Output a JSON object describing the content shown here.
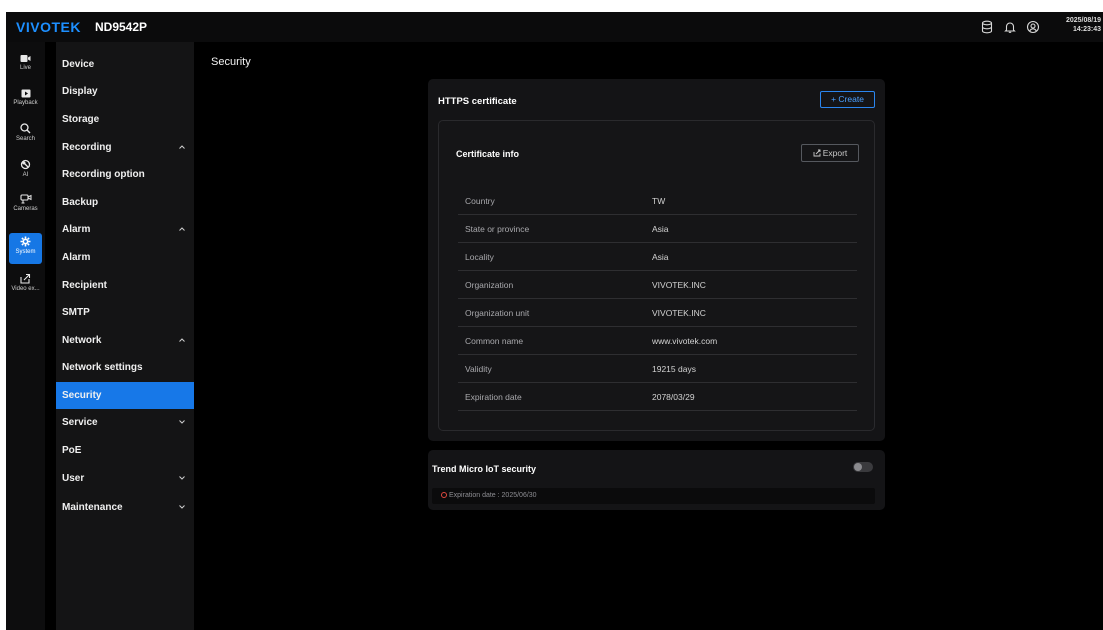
{
  "header": {
    "brand": "VIVOTEK",
    "model": "ND9542P",
    "date": "2025/08/19",
    "time": "14:23:43",
    "icons": [
      "database-icon",
      "bell-icon",
      "user-circle-icon"
    ]
  },
  "rail": [
    {
      "label": "Live",
      "icon": "camera-icon"
    },
    {
      "label": "Playback",
      "icon": "play-icon"
    },
    {
      "label": "Search",
      "icon": "search-icon"
    },
    {
      "label": "AI",
      "icon": "ai-icon"
    },
    {
      "label": "Cameras",
      "icon": "cameras-icon"
    },
    {
      "label": "System",
      "icon": "gear-icon",
      "active": true
    },
    {
      "label": "Video ex...",
      "icon": "export-icon"
    }
  ],
  "menu": {
    "items": [
      {
        "label": "Device"
      },
      {
        "label": "Display"
      },
      {
        "label": "Storage"
      },
      {
        "label": "Recording",
        "chevron": "up"
      },
      {
        "label": "Recording option"
      },
      {
        "label": "Backup"
      },
      {
        "label": "Alarm",
        "chevron": "up"
      },
      {
        "label": "Alarm"
      },
      {
        "label": "Recipient"
      },
      {
        "label": "SMTP"
      },
      {
        "label": "Network",
        "chevron": "up"
      },
      {
        "label": "Network settings"
      },
      {
        "label": "Security",
        "active": true
      },
      {
        "label": "Service",
        "chevron": "down"
      },
      {
        "label": "PoE"
      },
      {
        "label": "User",
        "chevron": "down"
      },
      {
        "label": "Maintenance",
        "chevron": "down"
      }
    ]
  },
  "page": {
    "title": "Security",
    "https": {
      "title": "HTTPS certificate",
      "create_label": "+ Create",
      "cert_title": "Certificate info",
      "export_label": "Export",
      "rows": [
        {
          "key": "Country",
          "value": "TW"
        },
        {
          "key": "State or province",
          "value": "Asia"
        },
        {
          "key": "Locality",
          "value": "Asia"
        },
        {
          "key": "Organization",
          "value": "VIVOTEK.INC"
        },
        {
          "key": "Organization unit",
          "value": "VIVOTEK.INC"
        },
        {
          "key": "Common name",
          "value": "www.vivotek.com"
        },
        {
          "key": "Validity",
          "value": "19215 days"
        },
        {
          "key": "Expiration date",
          "value": "2078/03/29"
        }
      ]
    },
    "trend": {
      "title": "Trend Micro IoT security",
      "enabled": false,
      "expiration": "Expiration date : 2025/06/30"
    }
  },
  "colors": {
    "accent": "#1778e8",
    "brand": "#1d8fff",
    "background": "#000000",
    "warning": "#e0483f"
  }
}
